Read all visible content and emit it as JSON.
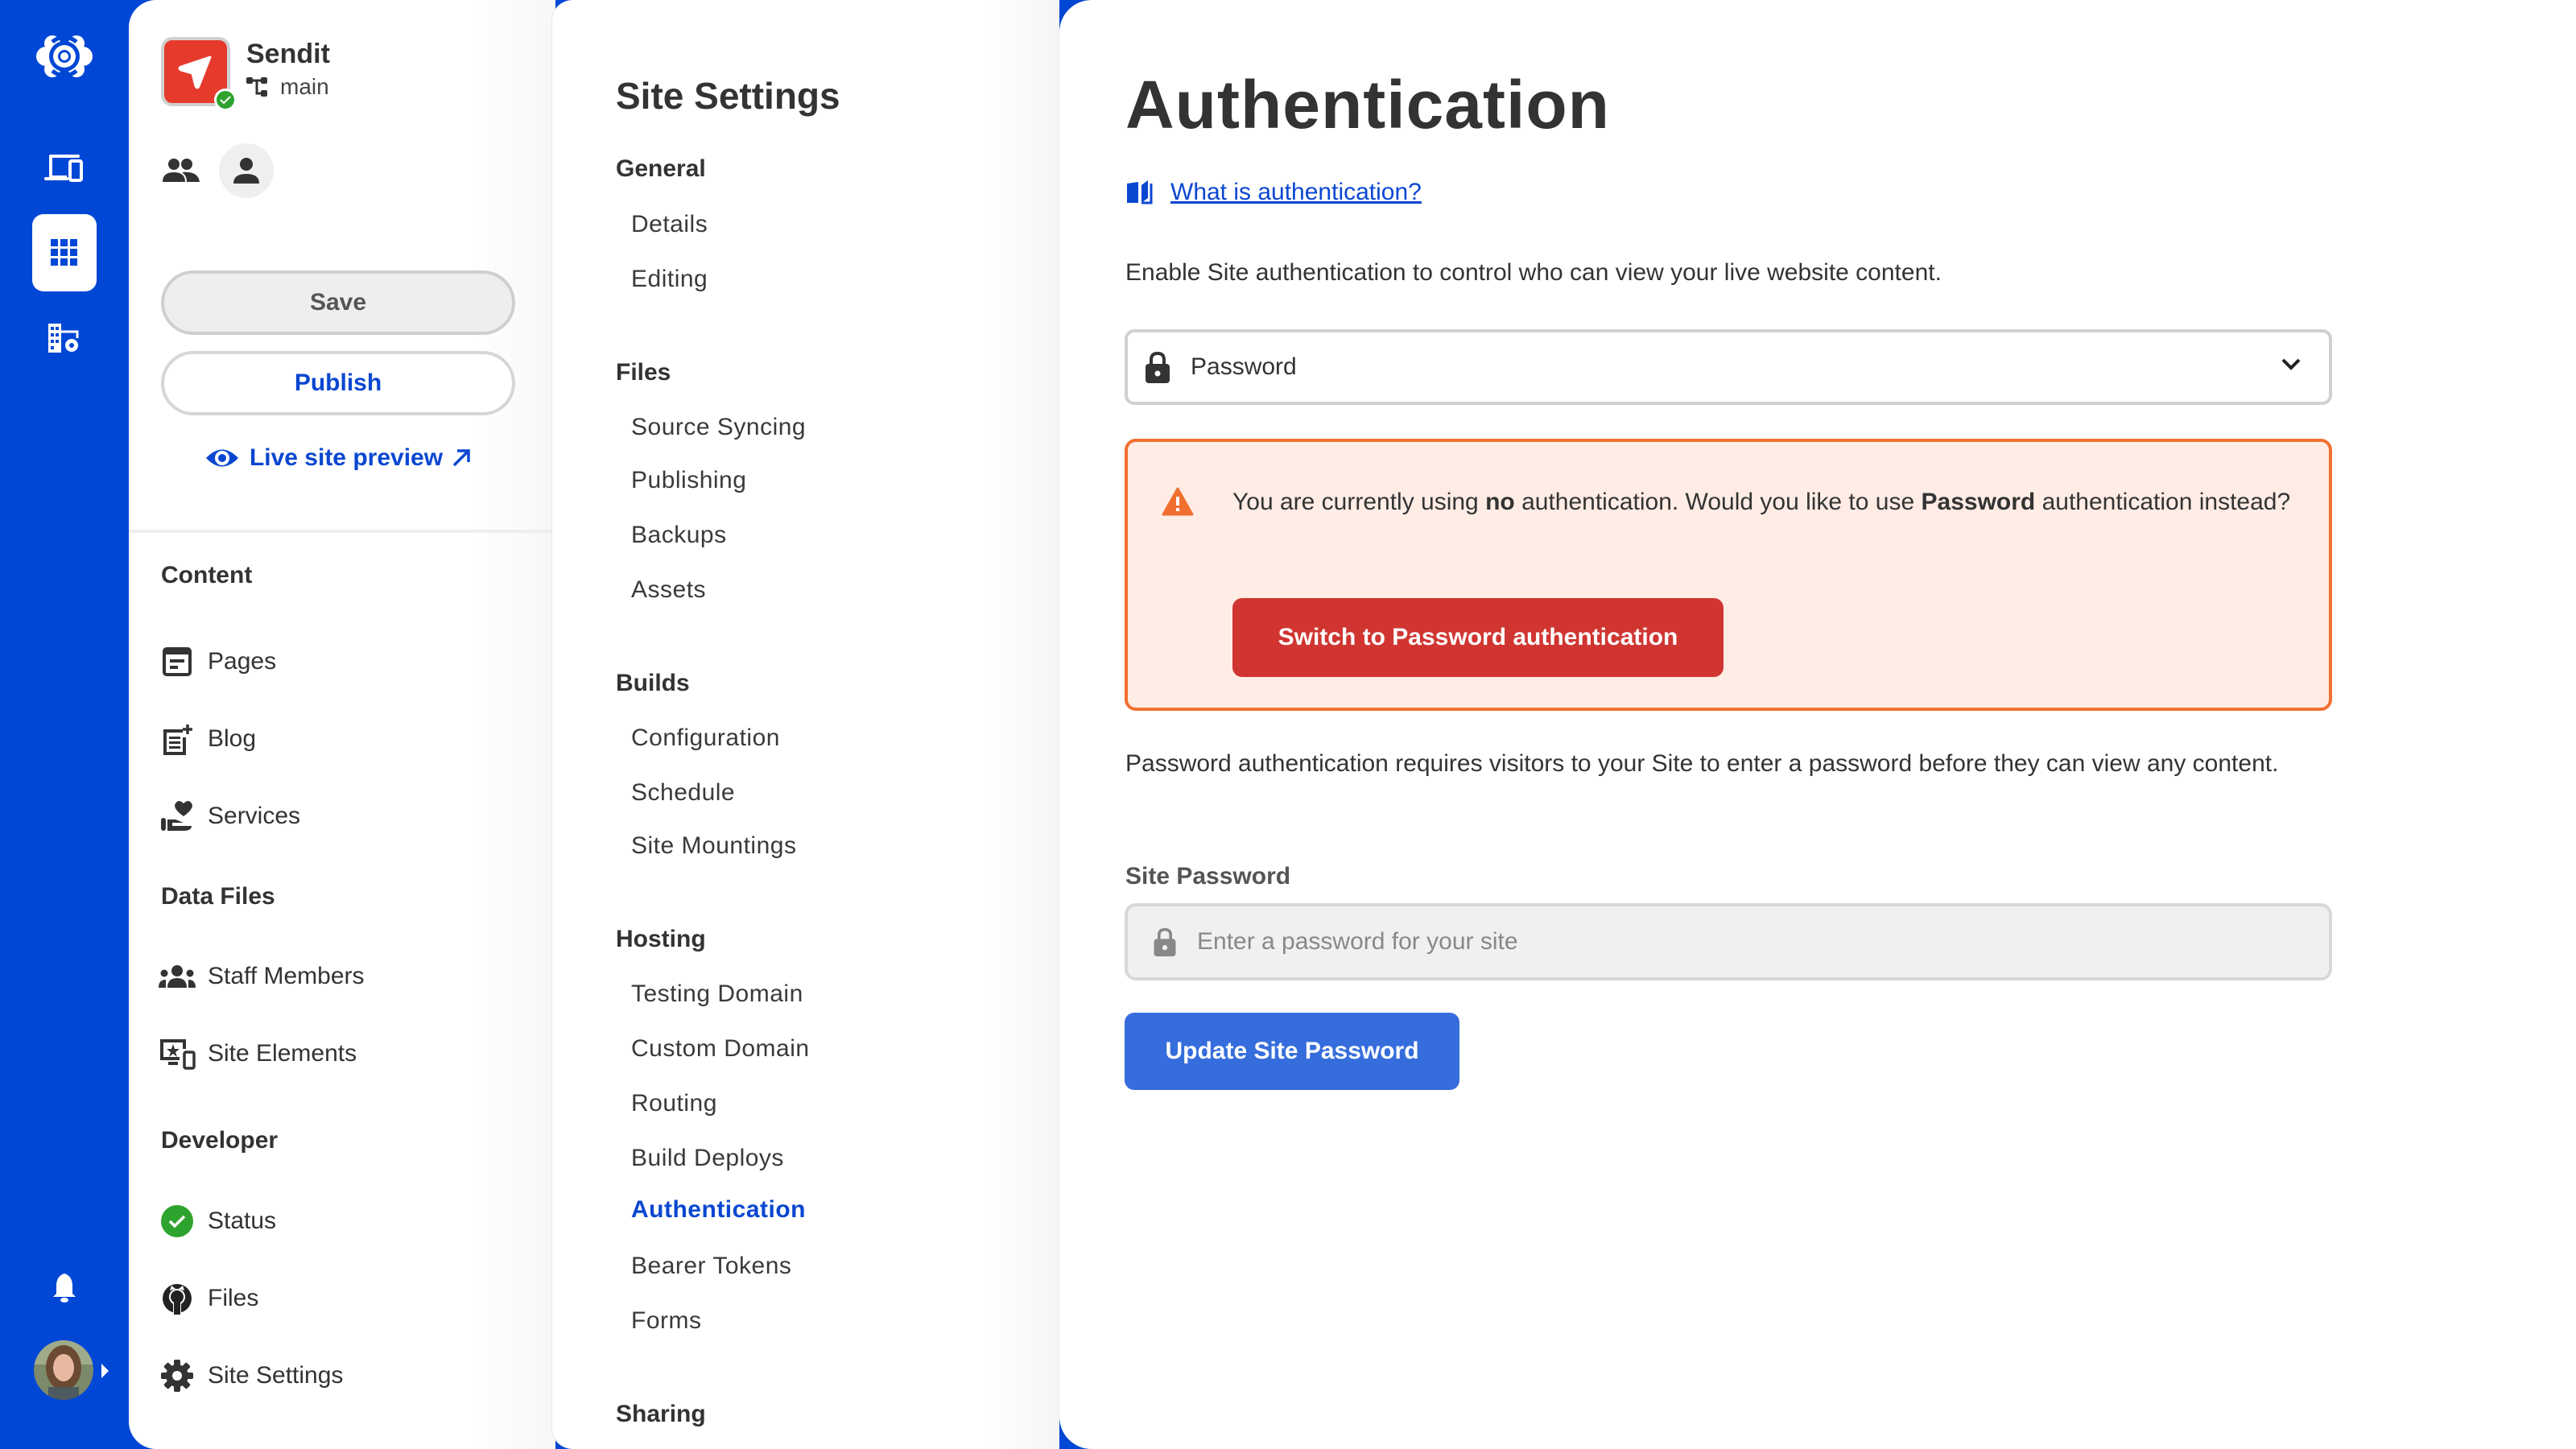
{
  "rail": {
    "items": [
      {
        "name": "logo",
        "icon": "cloudcannon-logo-icon"
      },
      {
        "name": "sites",
        "icon": "devices-icon"
      },
      {
        "name": "apps",
        "icon": "grid-icon",
        "active": true
      },
      {
        "name": "organization",
        "icon": "building-settings-icon"
      }
    ],
    "bottom": [
      {
        "name": "notifications",
        "icon": "bell-icon"
      },
      {
        "name": "account",
        "icon": "user-avatar"
      }
    ]
  },
  "site": {
    "name": "Sendit",
    "branch": "main",
    "status": "ok"
  },
  "leftnav": {
    "save_label": "Save",
    "publish_label": "Publish",
    "preview_label": "Live site preview",
    "sections": [
      {
        "title": "Content",
        "items": [
          {
            "label": "Pages",
            "icon": "page-icon"
          },
          {
            "label": "Blog",
            "icon": "post-add-icon"
          },
          {
            "label": "Services",
            "icon": "volunteer-icon"
          }
        ]
      },
      {
        "title": "Data Files",
        "items": [
          {
            "label": "Staff Members",
            "icon": "groups-icon"
          },
          {
            "label": "Site Elements",
            "icon": "devices-star-icon"
          }
        ]
      },
      {
        "title": "Developer",
        "items": [
          {
            "label": "Status",
            "icon": "check-circle-icon"
          },
          {
            "label": "Files",
            "icon": "github-icon"
          },
          {
            "label": "Site Settings",
            "icon": "gear-icon"
          }
        ]
      }
    ]
  },
  "settings": {
    "title": "Site Settings",
    "groups": [
      {
        "title": "General",
        "items": [
          "Details",
          "Editing"
        ]
      },
      {
        "title": "Files",
        "items": [
          "Source Syncing",
          "Publishing",
          "Backups",
          "Assets"
        ]
      },
      {
        "title": "Builds",
        "items": [
          "Configuration",
          "Schedule",
          "Site Mountings"
        ]
      },
      {
        "title": "Hosting",
        "items": [
          "Testing Domain",
          "Custom Domain",
          "Routing",
          "Build Deploys",
          "Authentication",
          "Bearer Tokens",
          "Forms"
        ]
      },
      {
        "title": "Sharing",
        "items": []
      }
    ],
    "active_item": "Authentication"
  },
  "main": {
    "title": "Authentication",
    "help_link": "What is authentication?",
    "intro": "Enable Site authentication to control who can view your live website content.",
    "auth_select": {
      "value": "Password"
    },
    "alert": {
      "text_pre": "You are currently using ",
      "text_bold1": "no",
      "text_mid": " authentication. Would you like to use ",
      "text_bold2": "Password",
      "text_post": " authentication instead?",
      "button": "Switch to Password authentication"
    },
    "description": "Password authentication requires visitors to your Site to enter a password before they can view any content.",
    "password_label": "Site Password",
    "password_placeholder": "Enter a password for your site",
    "password_value": "",
    "update_button": "Update Site Password"
  },
  "colors": {
    "brand_blue": "#0047d6",
    "link_blue": "#0a47d1",
    "button_blue": "#366ddc",
    "danger_red": "#d03531",
    "warning_orange": "#f07030",
    "warning_bg": "#feece5",
    "success_green": "#2ea32e"
  }
}
